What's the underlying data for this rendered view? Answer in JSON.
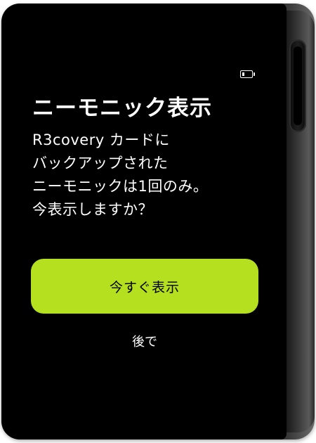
{
  "status": {
    "battery_icon": "battery-low-icon",
    "battery_level": 0.25
  },
  "title": "ニーモニック表示",
  "message_lines": [
    "R3covery カードに",
    "バックアップされた",
    "ニーモニックは1回のみ。",
    "今表示しますか？"
  ],
  "actions": {
    "show_now_label": "今すぐ表示",
    "later_label": "後で"
  },
  "colors": {
    "screen_bg": "#000000",
    "accent": "#b5e01f",
    "text": "#ffffff"
  }
}
